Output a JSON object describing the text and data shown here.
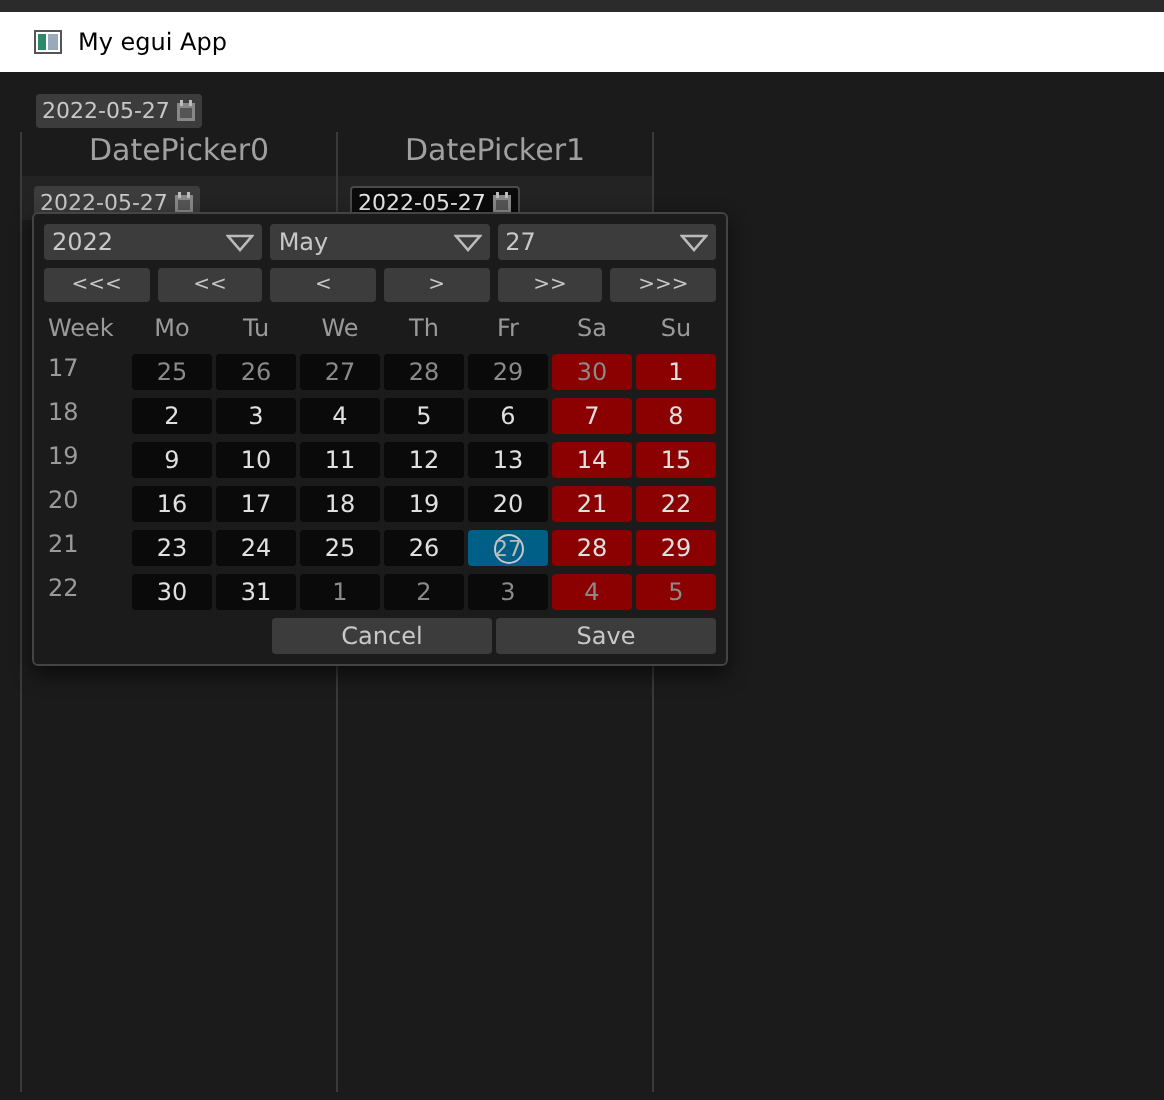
{
  "window": {
    "title": "My egui App"
  },
  "top_picker": {
    "value": "2022-05-27"
  },
  "table": {
    "columns": [
      "DatePicker0",
      "DatePicker1"
    ],
    "pickers": [
      {
        "value": "2022-05-27",
        "open": false
      },
      {
        "value": "2022-05-27",
        "open": true
      }
    ]
  },
  "popup": {
    "year": "2022",
    "month": "May",
    "day": "27",
    "nav": [
      "<<<",
      "<<",
      "<",
      ">",
      ">>",
      ">>>"
    ],
    "weekdays": [
      "Week",
      "Mo",
      "Tu",
      "We",
      "Th",
      "Fr",
      "Sa",
      "Su"
    ],
    "weeks": [
      {
        "week": "17",
        "days": [
          {
            "day": "25",
            "in_month": false,
            "weekend": false,
            "selected": false,
            "today": false
          },
          {
            "day": "26",
            "in_month": false,
            "weekend": false,
            "selected": false,
            "today": false
          },
          {
            "day": "27",
            "in_month": false,
            "weekend": false,
            "selected": false,
            "today": false
          },
          {
            "day": "28",
            "in_month": false,
            "weekend": false,
            "selected": false,
            "today": false
          },
          {
            "day": "29",
            "in_month": false,
            "weekend": false,
            "selected": false,
            "today": false
          },
          {
            "day": "30",
            "in_month": false,
            "weekend": true,
            "selected": false,
            "today": false
          },
          {
            "day": "1",
            "in_month": true,
            "weekend": true,
            "selected": false,
            "today": false
          }
        ]
      },
      {
        "week": "18",
        "days": [
          {
            "day": "2",
            "in_month": true,
            "weekend": false,
            "selected": false,
            "today": false
          },
          {
            "day": "3",
            "in_month": true,
            "weekend": false,
            "selected": false,
            "today": false
          },
          {
            "day": "4",
            "in_month": true,
            "weekend": false,
            "selected": false,
            "today": false
          },
          {
            "day": "5",
            "in_month": true,
            "weekend": false,
            "selected": false,
            "today": false
          },
          {
            "day": "6",
            "in_month": true,
            "weekend": false,
            "selected": false,
            "today": false
          },
          {
            "day": "7",
            "in_month": true,
            "weekend": true,
            "selected": false,
            "today": false
          },
          {
            "day": "8",
            "in_month": true,
            "weekend": true,
            "selected": false,
            "today": false
          }
        ]
      },
      {
        "week": "19",
        "days": [
          {
            "day": "9",
            "in_month": true,
            "weekend": false,
            "selected": false,
            "today": false
          },
          {
            "day": "10",
            "in_month": true,
            "weekend": false,
            "selected": false,
            "today": false
          },
          {
            "day": "11",
            "in_month": true,
            "weekend": false,
            "selected": false,
            "today": false
          },
          {
            "day": "12",
            "in_month": true,
            "weekend": false,
            "selected": false,
            "today": false
          },
          {
            "day": "13",
            "in_month": true,
            "weekend": false,
            "selected": false,
            "today": false
          },
          {
            "day": "14",
            "in_month": true,
            "weekend": true,
            "selected": false,
            "today": false
          },
          {
            "day": "15",
            "in_month": true,
            "weekend": true,
            "selected": false,
            "today": false
          }
        ]
      },
      {
        "week": "20",
        "days": [
          {
            "day": "16",
            "in_month": true,
            "weekend": false,
            "selected": false,
            "today": false
          },
          {
            "day": "17",
            "in_month": true,
            "weekend": false,
            "selected": false,
            "today": false
          },
          {
            "day": "18",
            "in_month": true,
            "weekend": false,
            "selected": false,
            "today": false
          },
          {
            "day": "19",
            "in_month": true,
            "weekend": false,
            "selected": false,
            "today": false
          },
          {
            "day": "20",
            "in_month": true,
            "weekend": false,
            "selected": false,
            "today": false
          },
          {
            "day": "21",
            "in_month": true,
            "weekend": true,
            "selected": false,
            "today": false
          },
          {
            "day": "22",
            "in_month": true,
            "weekend": true,
            "selected": false,
            "today": false
          }
        ]
      },
      {
        "week": "21",
        "days": [
          {
            "day": "23",
            "in_month": true,
            "weekend": false,
            "selected": false,
            "today": false
          },
          {
            "day": "24",
            "in_month": true,
            "weekend": false,
            "selected": false,
            "today": false
          },
          {
            "day": "25",
            "in_month": true,
            "weekend": false,
            "selected": false,
            "today": false
          },
          {
            "day": "26",
            "in_month": true,
            "weekend": false,
            "selected": false,
            "today": false
          },
          {
            "day": "27",
            "in_month": true,
            "weekend": false,
            "selected": true,
            "today": true
          },
          {
            "day": "28",
            "in_month": true,
            "weekend": true,
            "selected": false,
            "today": false
          },
          {
            "day": "29",
            "in_month": true,
            "weekend": true,
            "selected": false,
            "today": false
          }
        ]
      },
      {
        "week": "22",
        "days": [
          {
            "day": "30",
            "in_month": true,
            "weekend": false,
            "selected": false,
            "today": false
          },
          {
            "day": "31",
            "in_month": true,
            "weekend": false,
            "selected": false,
            "today": false
          },
          {
            "day": "1",
            "in_month": false,
            "weekend": false,
            "selected": false,
            "today": false
          },
          {
            "day": "2",
            "in_month": false,
            "weekend": false,
            "selected": false,
            "today": false
          },
          {
            "day": "3",
            "in_month": false,
            "weekend": false,
            "selected": false,
            "today": false
          },
          {
            "day": "4",
            "in_month": false,
            "weekend": true,
            "selected": false,
            "today": false
          },
          {
            "day": "5",
            "in_month": false,
            "weekend": true,
            "selected": false,
            "today": false
          }
        ]
      }
    ],
    "buttons": [
      "Cancel",
      "Save"
    ]
  }
}
